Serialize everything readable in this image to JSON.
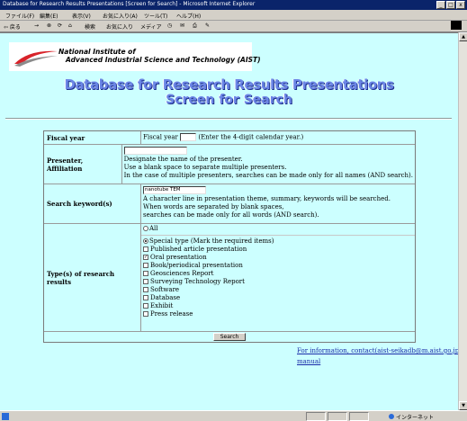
{
  "window": {
    "title": "Database for Research Results Presentations [Screen for Search] - Microsoft Internet Explorer",
    "minimize": "_",
    "maximize": "□",
    "close": "x"
  },
  "menu": [
    "ファイル(F)",
    "編集(E)",
    "表示(V)",
    "お気に入り(A)",
    "ツール(T)",
    "ヘルプ(H)"
  ],
  "toolbar": {
    "back": "⇦ 戻る",
    "search": "検索",
    "favorites": "お気に入り",
    "media": "メディア"
  },
  "logo": {
    "line1": "National Institute of",
    "line2": "Advanced Industrial Science and Technology (AIST)",
    "colors": {
      "swoosh_red": "#d8232a",
      "swoosh_gray": "#8c8c8c"
    }
  },
  "heading": {
    "line1": "Database for Research Results Presentations",
    "line2": "Screen for Search",
    "color": "#6b86e6"
  },
  "form": {
    "fiscal_year": {
      "label": "Fiscal year",
      "prefix": "Fiscal year",
      "value": "",
      "hint": "(Enter the 4-digit calendar year.)"
    },
    "presenter": {
      "label1": "Presenter,",
      "label2": "Affiliation",
      "value": "",
      "help1": "Designate the name of the presenter.",
      "help2": "Use a blank space to separate multiple presenters.",
      "help3": "In the case of multiple presenters, searches can be made only for all names (AND search)."
    },
    "keyword": {
      "label": "Search keyword(s)",
      "value": "nanotube TEM",
      "help1": "A character line in presentation theme, summary, keywords will be searched.",
      "help2": "When words are separated by blank spaces,",
      "help3": "searches can be made only for all words (AND search)."
    },
    "types": {
      "label": "Type(s) of research results",
      "all_label": "All",
      "special_label": "Special type (Mark the required items)",
      "items": [
        {
          "label": "Published article presentation",
          "checked": false
        },
        {
          "label": "Oral presentation",
          "checked": true
        },
        {
          "label": "Book/periodical presentation",
          "checked": false
        },
        {
          "label": "Geosciences Report",
          "checked": false
        },
        {
          "label": "Surveying Technology Report",
          "checked": false
        },
        {
          "label": "Software",
          "checked": false
        },
        {
          "label": "Database",
          "checked": false
        },
        {
          "label": "Exhibit",
          "checked": false
        },
        {
          "label": "Press release",
          "checked": false
        }
      ]
    },
    "search_button": "Search"
  },
  "footer": {
    "contact": "For information, contact(aist-seikadb@m.aist.go.jp)",
    "manual": "manual"
  },
  "status": {
    "zone": "インターネット"
  },
  "colors": {
    "page_bg": "#ccffff",
    "titlebar": "#0a246a",
    "link": "#1a2aa8"
  }
}
